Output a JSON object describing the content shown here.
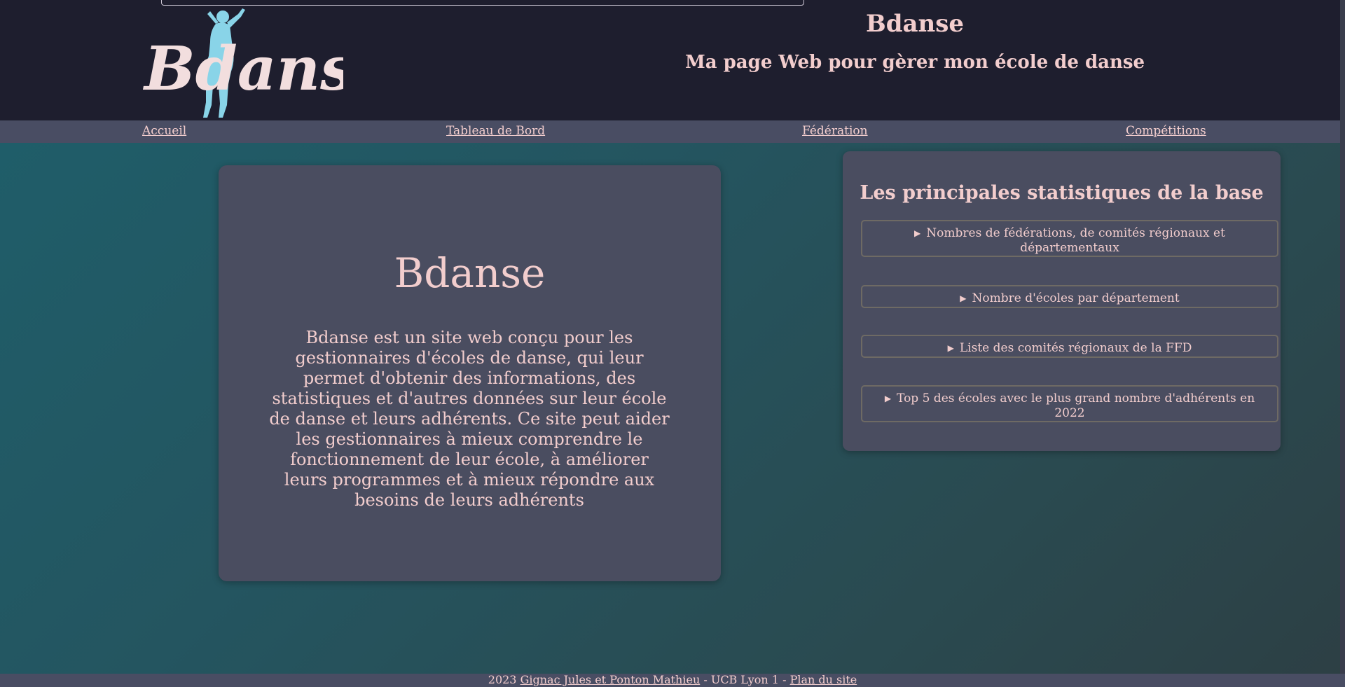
{
  "header": {
    "logo_text": "Bdanse",
    "title": "Bdanse",
    "subtitle": "Ma page Web pour gèrer mon école de danse"
  },
  "nav": {
    "items": [
      {
        "label": "Accueil"
      },
      {
        "label": "Tableau de Bord"
      },
      {
        "label": "Fédération"
      },
      {
        "label": "Compétitions"
      }
    ]
  },
  "main": {
    "title": "Bdanse",
    "description": "Bdanse est un site web conçu pour les gestionnaires d'écoles de danse, qui leur permet d'obtenir des informations, des statistiques et d'autres données sur leur école de danse et leurs adhérents. Ce site peut aider les gestionnaires à mieux comprendre le fonctionnement de leur école, à améliorer leurs programmes et à mieux répondre aux besoins de leurs adhérents"
  },
  "stats": {
    "title": "Les principales statistiques de la base",
    "items": [
      {
        "label": "Nombres de fédérations, de comités régionaux et départementaux"
      },
      {
        "label": "Nombre d'écoles par département"
      },
      {
        "label": "Liste des comités régionaux de la FFD"
      },
      {
        "label": "Top 5 des écoles avec le plus grand nombre d'adhérents en 2022"
      }
    ]
  },
  "footer": {
    "year": "2023",
    "authors_link": "Gignac Jules et Ponton Mathieu",
    "separator1": " - UCB Lyon 1 - ",
    "sitemap_link": "Plan du site"
  },
  "icons": {
    "disclosure": "triangle-right-icon"
  },
  "colors": {
    "header_bg": "#1e1e2e",
    "nav_bg": "#494d63",
    "card_bg": "#4a4d60",
    "text": "#f2cdcd",
    "logo_figure": "#89d4e8"
  }
}
